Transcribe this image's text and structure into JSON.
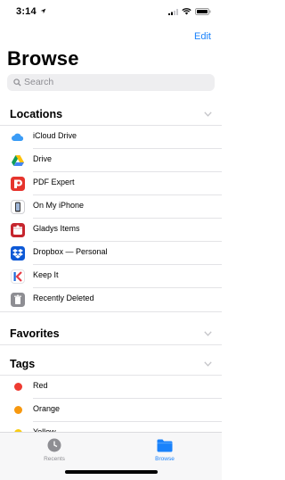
{
  "status_bar": {
    "time": "3:14"
  },
  "header": {
    "edit_label": "Edit",
    "title": "Browse"
  },
  "search": {
    "placeholder": "Search"
  },
  "locations": {
    "title": "Locations",
    "items": [
      {
        "label": "iCloud Drive",
        "icon": "icloud-icon"
      },
      {
        "label": "Drive",
        "icon": "google-drive-icon"
      },
      {
        "label": "PDF Expert",
        "icon": "pdf-expert-icon"
      },
      {
        "label": "On My iPhone",
        "icon": "iphone-icon"
      },
      {
        "label": "Gladys Items",
        "icon": "gladys-icon"
      },
      {
        "label": "Dropbox — Personal",
        "icon": "dropbox-icon"
      },
      {
        "label": "Keep It",
        "icon": "keep-it-icon"
      },
      {
        "label": "Recently Deleted",
        "icon": "trash-icon"
      }
    ]
  },
  "favorites": {
    "title": "Favorites"
  },
  "tags": {
    "title": "Tags",
    "items": [
      {
        "label": "Red",
        "color": "#ee3b31"
      },
      {
        "label": "Orange",
        "color": "#f7980f"
      },
      {
        "label": "Yellow",
        "color": "#f9cc14"
      }
    ]
  },
  "tabbar": {
    "tabs": [
      {
        "label": "Recents",
        "icon": "clock-icon",
        "active": false
      },
      {
        "label": "Browse",
        "icon": "folder-icon",
        "active": true
      }
    ]
  },
  "colors": {
    "accent": "#1a82fb",
    "inactive": "#8e8e93"
  }
}
